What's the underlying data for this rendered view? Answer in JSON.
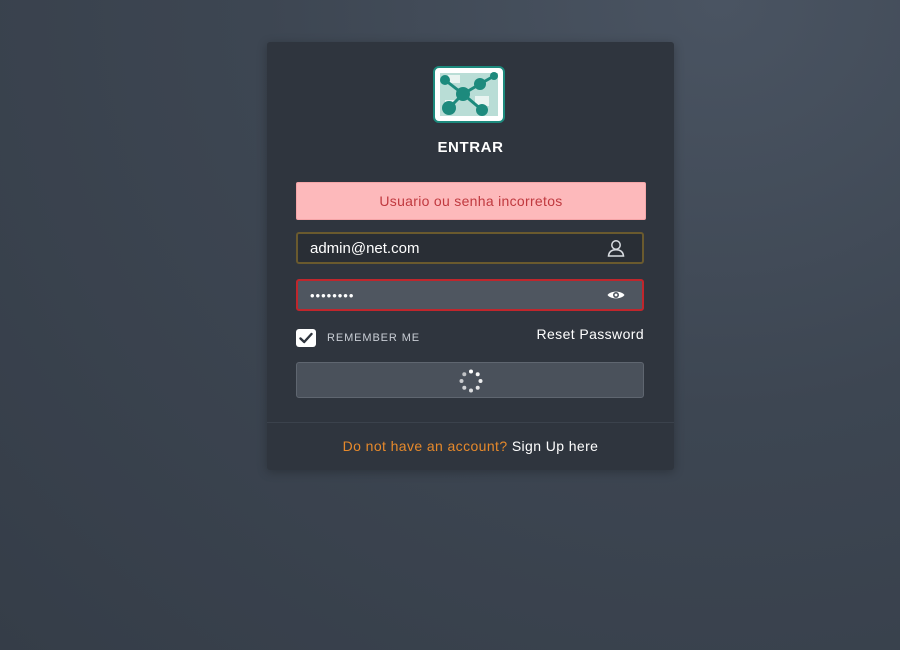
{
  "login": {
    "title": "ENTRAR",
    "error_message": "Usuario ou senha incorretos",
    "email_value": "admin@net.com",
    "password_value": "••••••••",
    "remember_label": "REMEMBER ME",
    "remember_checked": true,
    "reset_password_label": "Reset Password",
    "submit_state": "loading",
    "footer_prompt": "Do not have an account?",
    "footer_signup": "Sign Up here"
  },
  "icons": {
    "logo": "network-graph-logo-icon",
    "email": "user-icon",
    "password": "eye-icon",
    "remember": "checkmark-icon",
    "submit": "loading-spinner-icon"
  },
  "colors": {
    "background": "#3d4652",
    "card": "#2f353e",
    "error_bg": "#fdb9bb",
    "error_text": "#c0393f",
    "password_border": "#c0262c",
    "footer_prompt": "#e6892b",
    "logo_teal": "#1d8a7d"
  }
}
